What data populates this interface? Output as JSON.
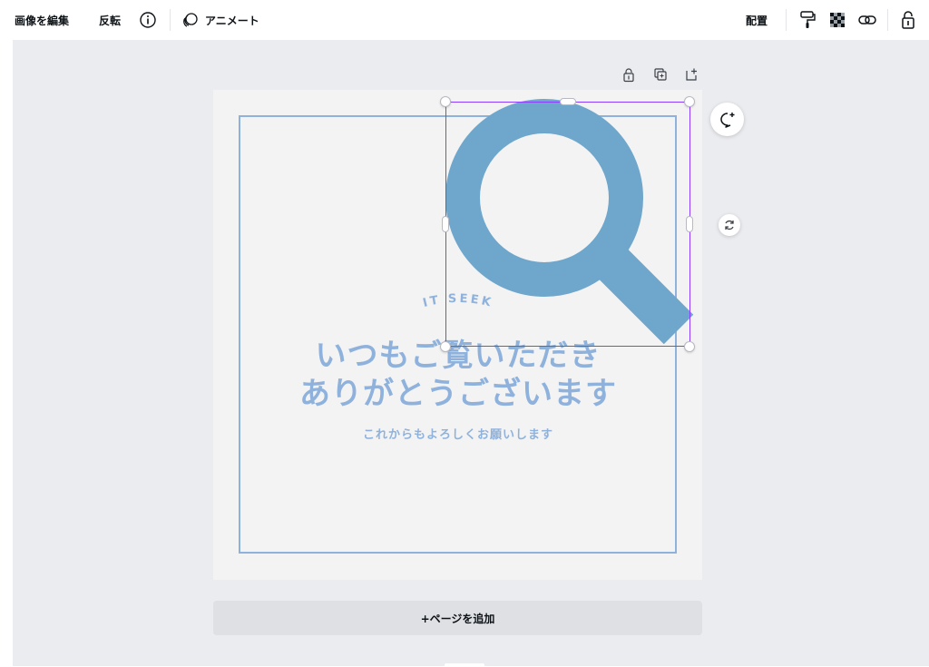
{
  "toolbar": {
    "edit_image": "画像を編集",
    "flip": "反転",
    "animate": "アニメート",
    "position": "配置",
    "icons": [
      "info-icon",
      "animate-icon",
      "style-paint-roller-icon",
      "transparency-icon",
      "link-icon",
      "lock-icon"
    ]
  },
  "page_tools": {
    "icons": [
      "lock-icon",
      "duplicate-icon",
      "add-page-icon"
    ]
  },
  "design": {
    "brand": "IT SEEK",
    "headline_line1": "いつもご覧いただき",
    "headline_line2": "ありがとうございます",
    "subline": "これからもよろしくお願いします",
    "accent_color": "#8fb2dc",
    "magnifier_color": "#6fa7cc"
  },
  "selection": {
    "color": "#8b3dff",
    "comment_button_icon": "comment-add-icon",
    "rotate_button_icon": "rotate-icon"
  },
  "add_page": {
    "label": "+ページを追加"
  }
}
